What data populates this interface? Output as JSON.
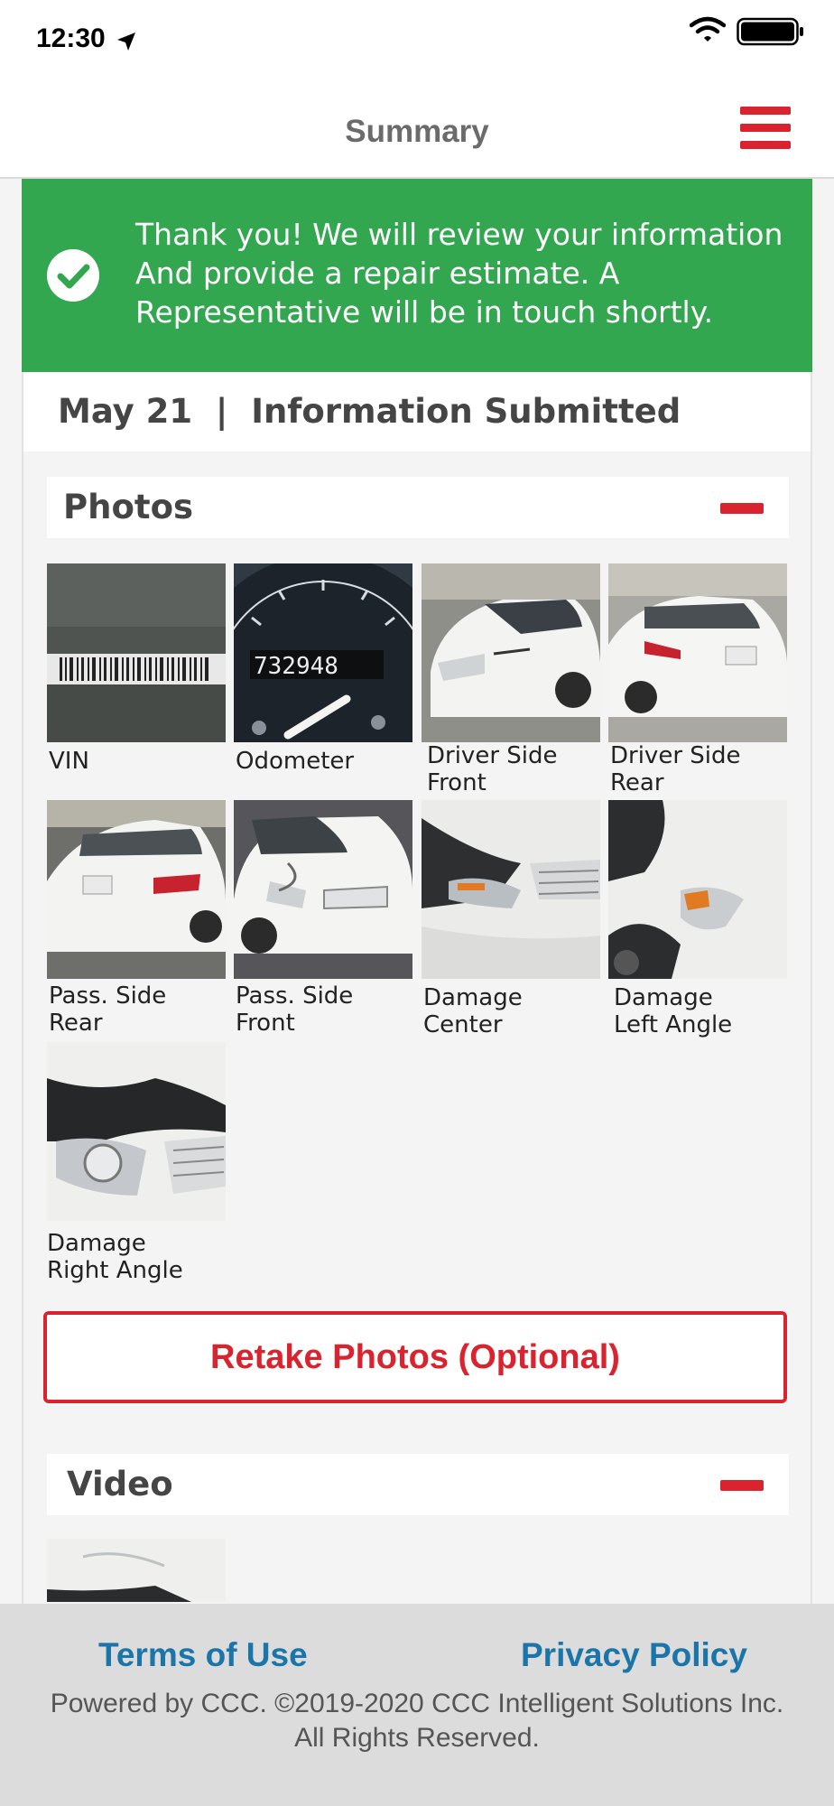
{
  "status_bar": {
    "time": "12:30"
  },
  "header": {
    "title": "Summary"
  },
  "banner": {
    "lines": [
      "Thank you! We will review your information",
      "And provide a repair estimate. A",
      "Representative will be in touch shortly."
    ]
  },
  "submission": {
    "date": "May 21",
    "separator": "|",
    "status": "Information Submitted"
  },
  "photos_section": {
    "title": "Photos",
    "items": [
      {
        "caption_line1": "VIN",
        "caption_line2": ""
      },
      {
        "caption_line1": "Odometer",
        "caption_line2": ""
      },
      {
        "caption_line1": "Driver Side",
        "caption_line2": "Front"
      },
      {
        "caption_line1": "Driver Side",
        "caption_line2": "Rear"
      },
      {
        "caption_line1": "Pass. Side",
        "caption_line2": "Rear"
      },
      {
        "caption_line1": "Pass. Side",
        "caption_line2": "Front"
      },
      {
        "caption_line1": "Damage",
        "caption_line2": "Center"
      },
      {
        "caption_line1": "Damage",
        "caption_line2": "Left Angle"
      },
      {
        "caption_line1": "Damage",
        "caption_line2": "Right Angle"
      }
    ],
    "odometer_reading": "732948",
    "retake_button": "Retake Photos (Optional)"
  },
  "video_section": {
    "title": "Video"
  },
  "footer": {
    "terms_link": "Terms of Use",
    "privacy_link": "Privacy Policy",
    "copyright_line1": "Powered by CCC. ©2019-2020 CCC Intelligent Solutions Inc.",
    "copyright_line2": "All Rights Reserved."
  },
  "colors": {
    "accent_red": "#d9232e",
    "success_green": "#33a650",
    "link_blue": "#1b75a8"
  },
  "icons": [
    "location-arrow-icon",
    "wifi-icon",
    "battery-icon",
    "hamburger-menu-icon",
    "checkmark-icon",
    "collapse-minus-icon"
  ]
}
